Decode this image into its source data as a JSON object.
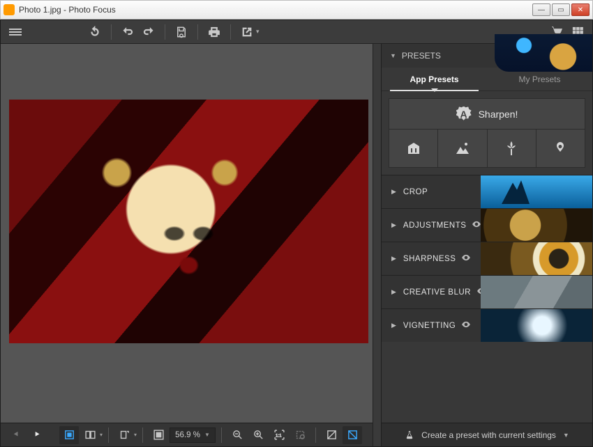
{
  "window": {
    "title": "Photo 1.jpg - Photo Focus"
  },
  "side": {
    "header": "PRESETS",
    "tabs": {
      "app": "App Presets",
      "my": "My Presets"
    },
    "sharpen_label": "Sharpen!",
    "sections": {
      "crop": "CROP",
      "adjustments": "ADJUSTMENTS",
      "sharpness": "SHARPNESS",
      "creative_blur": "CREATIVE BLUR",
      "vignetting": "VIGNETTING"
    },
    "footer": "Create a preset with current settings"
  },
  "bottom": {
    "zoom": "56.9 %"
  }
}
